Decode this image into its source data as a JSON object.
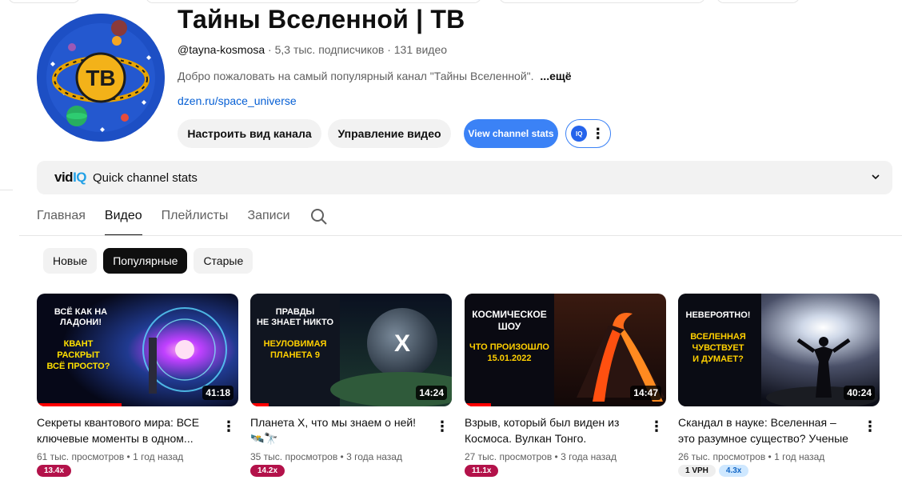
{
  "channel": {
    "title": "Тайны Вселенной | ТВ",
    "avatar_text": "ТВ",
    "handle": "@tayna-kosmosa",
    "subscribers": "5,3 тыс. подписчиков",
    "video_count": "131 видео",
    "description": "Добро пожаловать на самый популярный канал \"Тайны Вселенной\".",
    "more_label": "...ещё",
    "link": "dzen.ru/space_universe"
  },
  "actions": {
    "customize_label": "Настроить вид канала",
    "manage_label": "Управление видео",
    "stats_label": "View channel stats",
    "iq_logo": "IQ"
  },
  "vidiq": {
    "logo_main": "vid",
    "logo_iq": "IQ",
    "label": "Quick channel stats"
  },
  "tabs": [
    {
      "label": "Главная",
      "active": false
    },
    {
      "label": "Видео",
      "active": true
    },
    {
      "label": "Плейлисты",
      "active": false
    },
    {
      "label": "Записи",
      "active": false
    }
  ],
  "chips": [
    {
      "label": "Новые",
      "active": false
    },
    {
      "label": "Популярные",
      "active": true
    },
    {
      "label": "Старые",
      "active": false
    }
  ],
  "videos": [
    {
      "title": "Секреты квантового мира: ВСЕ ключевые моменты в одном...",
      "views": "61 тыс. просмотров",
      "age": "1 год назад",
      "duration": "41:18",
      "badge": "13.4x",
      "thumb_lines": [
        "ВСЁ КАК НА",
        "ЛАДОНИ!",
        "КВАНТ",
        "РАСКРЫТ",
        "ВСЁ ПРОСТО?"
      ],
      "watched": 0.42
    },
    {
      "title": "Планета Х, что мы знаем о ней! 🛰️🔭",
      "views": "35 тыс. просмотров",
      "age": "3 года назад",
      "duration": "14:24",
      "badge": "14.2x",
      "thumb_lines": [
        "ПРАВДЫ",
        "НЕ ЗНАЕТ НИКТО",
        "НЕУЛОВИМАЯ",
        "ПЛАНЕТА 9",
        "X"
      ],
      "watched": 0.09
    },
    {
      "title": "Взрыв, который был виден из Космоса. Вулкан Тонго.",
      "views": "27 тыс. просмотров",
      "age": "3 года назад",
      "duration": "14:47",
      "badge": "11.1x",
      "thumb_lines": [
        "КОСМИЧЕСКОЕ",
        "ШОУ",
        "ЧТО ПРОИЗОШЛО",
        "15.01.2022"
      ],
      "watched": 0.13
    },
    {
      "title": "Скандал в науке: Вселенная – это разумное существо? Ученые в...",
      "views": "26 тыс. просмотров",
      "age": "1 год назад",
      "duration": "40:24",
      "badge": "4.3x",
      "vph": "1 VPH",
      "thumb_lines": [
        "НЕВЕРОЯТНО!",
        "ВСЕЛЕННАЯ",
        "ЧУВСТВУЕТ",
        "И ДУМАЕТ?"
      ],
      "watched": 0.0
    }
  ]
}
